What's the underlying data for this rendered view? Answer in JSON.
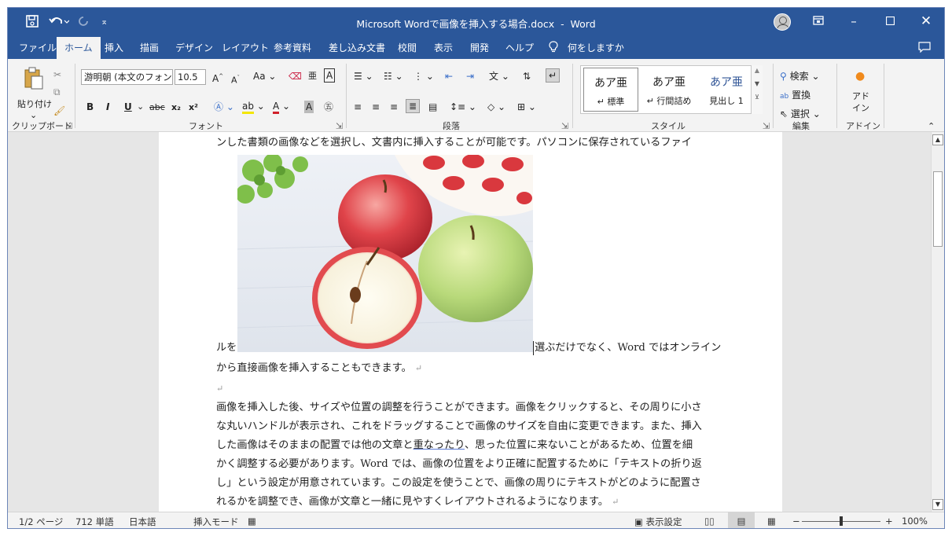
{
  "title": {
    "text": "Microsoft Wordで画像を挿入する場合.docx  -  Word",
    "qat_save_icon": "save-icon",
    "qat_undo_icon": "undo-icon",
    "qat_redo_icon": "redo-icon",
    "qat_customize_icon": "customize-icon"
  },
  "tabs": [
    "ファイル",
    "ホーム",
    "挿入",
    "描画",
    "デザイン",
    "レイアウト",
    "参考資料",
    "差し込み文書",
    "校閲",
    "表示",
    "開発",
    "ヘルプ",
    "何をしますか"
  ],
  "ribbon": {
    "clipboard": {
      "paste": "貼り付け",
      "label": "クリップボード"
    },
    "font": {
      "font_name": "游明朝 (本文のフォン",
      "font_size": "10.5",
      "label": "フォント",
      "bold": "B",
      "italic": "I",
      "underline": "U",
      "strike": "abc",
      "sub": "x₂",
      "sup": "x²",
      "grow": "A",
      "shrink": "A",
      "case": "Aa"
    },
    "paragraph": {
      "label": "段落"
    },
    "styles": {
      "label": "スタイル",
      "items": [
        {
          "sample": "あア亜",
          "name": "↵ 標準"
        },
        {
          "sample": "あア亜",
          "name": "↵ 行間詰め"
        },
        {
          "sample": "あア亜",
          "name": "見出し 1"
        }
      ]
    },
    "editing": {
      "find": "検索",
      "replace": "置換",
      "select": "選択",
      "label": "編集"
    },
    "addin": {
      "button": "アド\nイン",
      "label": "アドイン"
    }
  },
  "document": {
    "line1": "ンした書類の画像などを選択し、文書内に挿入することが可能です。パソコンに保存されているファイ",
    "line2a": "ルを",
    "line2b": "選ぶだけでなく、Word ではオンライン",
    "line3": "から直接画像を挿入することもできます。",
    "p2_line1": "画像を挿入した後、サイズや位置の調整を行うことができます。画像をクリックすると、その周りに小さ",
    "p2_line2": "な丸いハンドルが表示され、これをドラッグすることで画像のサイズを自由に変更できます。また、挿入",
    "p2_line3a": "した画像はそのままの配置では他の文章と",
    "p2_line3b": "重なったり",
    "p2_line3c": "、思った位置に来ないことがあるため、位置を細",
    "p2_line4": "かく調整する必要があります。Word では、画像の位置をより正確に配置するために「テキストの折り返",
    "p2_line5": "し」という設定が用意されています。この設定を使うことで、画像の周りにテキストがどのように配置さ",
    "p2_line6": "れるかを調整でき、画像が文章と一緒に見やすくレイアウトされるようになります。",
    "para_mark": "↵"
  },
  "status": {
    "page": "1/2 ページ",
    "words": "712 単語",
    "lang": "日本語",
    "mode": "挿入モード",
    "display": "表示設定",
    "zoom": "100%",
    "zoom_minus": "−",
    "zoom_plus": "+"
  }
}
